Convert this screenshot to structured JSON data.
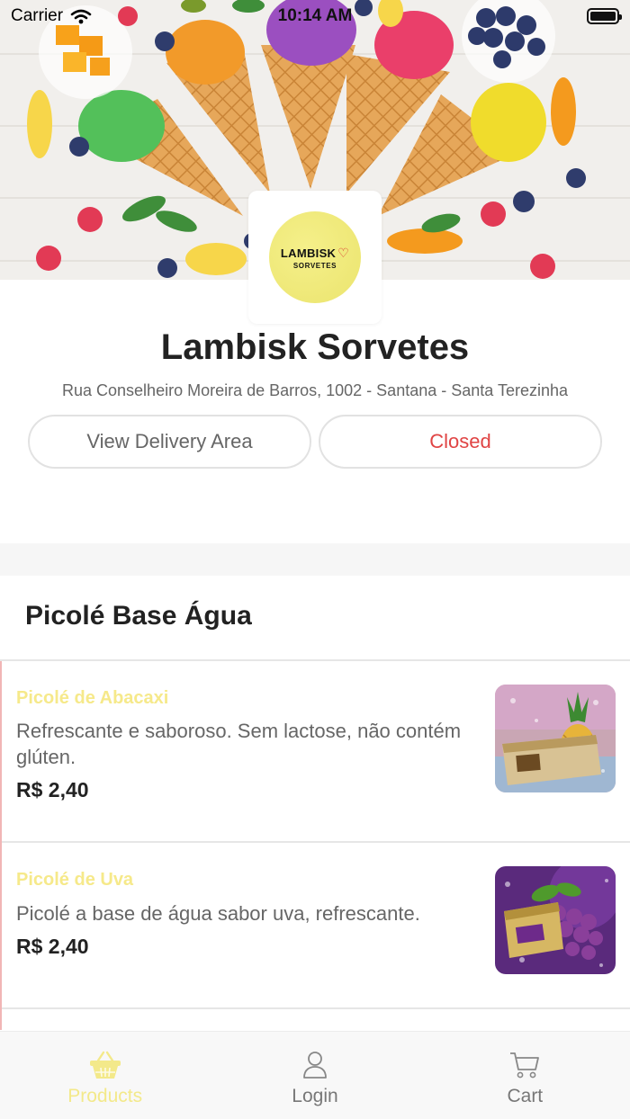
{
  "status_bar": {
    "carrier": "Carrier",
    "time": "10:14 AM"
  },
  "store": {
    "logo_name": "LAMBISK",
    "logo_sub": "SORVETES",
    "name": "Lambisk Sorvetes",
    "address": "Rua Conselheiro Moreira de Barros, 1002 - Santana - Santa Terezinha",
    "delivery_button": "View Delivery Area",
    "status_button": "Closed"
  },
  "section": {
    "title": "Picolé Base Água"
  },
  "products": [
    {
      "name": "Picolé de Abacaxi",
      "description": "Refrescante e saboroso. Sem lactose, não contém glúten.",
      "price": "R$ 2,40"
    },
    {
      "name": "Picolé de Uva",
      "description": "Picolé a base de água sabor uva, refrescante.",
      "price": "R$ 2,40"
    }
  ],
  "tabs": [
    {
      "label": "Products",
      "icon": "basket-icon",
      "active": true
    },
    {
      "label": "Login",
      "icon": "user-icon",
      "active": false
    },
    {
      "label": "Cart",
      "icon": "cart-icon",
      "active": false
    }
  ],
  "colors": {
    "accent_active_tab": "#f3e98a",
    "product_name": "#f6e98a",
    "closed_status": "#e04444",
    "logo_badge": "#f0ea7c"
  }
}
